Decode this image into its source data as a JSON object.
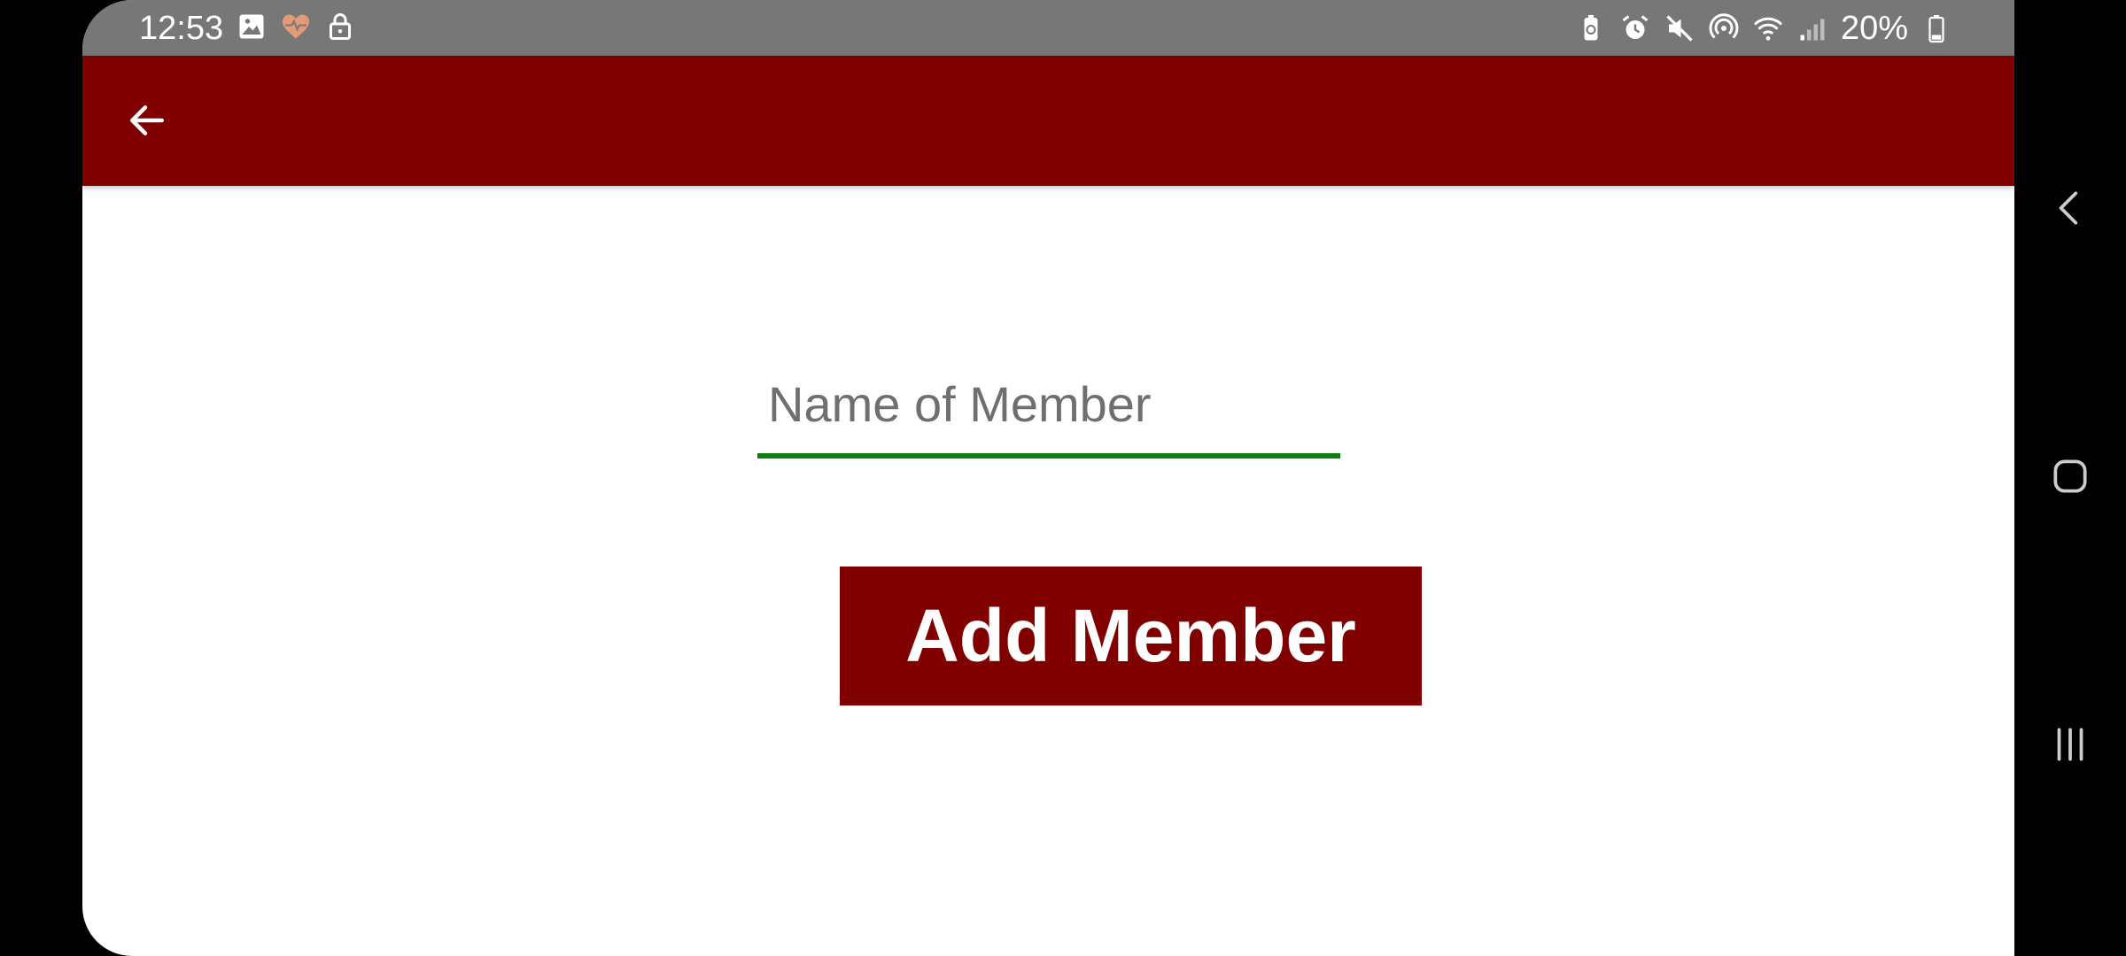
{
  "status_bar": {
    "time": "12:53",
    "battery_percent": "20%",
    "left_icons": [
      "image-icon",
      "health-icon",
      "lock-icon"
    ],
    "right_icons": [
      "battery-saver-icon",
      "alarm-icon",
      "mute-icon",
      "hotspot-icon",
      "wifi-icon",
      "signal-icon",
      "battery-icon"
    ]
  },
  "toolbar": {
    "back_icon": "arrow-left-icon"
  },
  "form": {
    "name_placeholder": "Name of Member",
    "name_value": "",
    "add_button_label": "Add Member"
  },
  "nav": {
    "icons": [
      "nav-back-icon",
      "nav-home-icon",
      "nav-recents-icon"
    ]
  },
  "colors": {
    "toolbar": "#800000",
    "button": "#800000",
    "status_bar": "#777777",
    "input_underline": "#0f7f10"
  }
}
